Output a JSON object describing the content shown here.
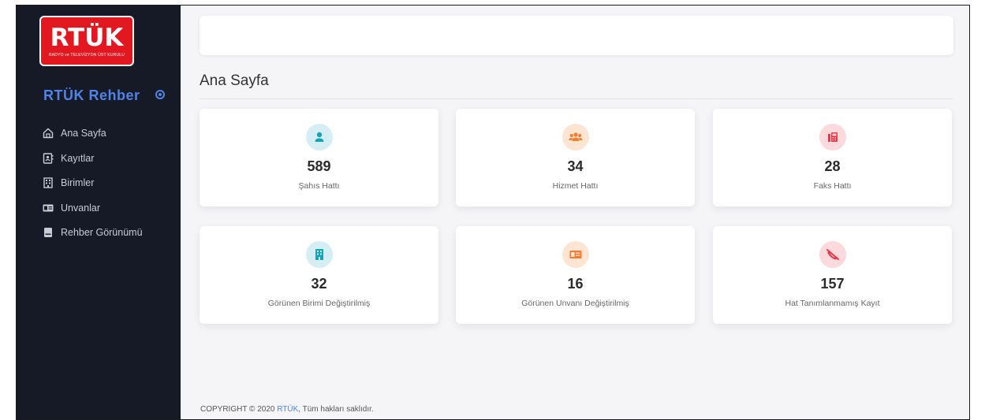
{
  "logo": {
    "main": "RTÜK",
    "sub": "RADYO ve TELEVİZYON ÜST KURULU"
  },
  "brand": {
    "title": "RTÜK Rehber"
  },
  "nav": {
    "items": [
      {
        "label": "Ana Sayfa",
        "icon": "home-icon"
      },
      {
        "label": "Kayıtlar",
        "icon": "contact-book-icon"
      },
      {
        "label": "Birimler",
        "icon": "building-icon"
      },
      {
        "label": "Unvanlar",
        "icon": "id-card-icon"
      },
      {
        "label": "Rehber Görünümü",
        "icon": "book-icon"
      }
    ]
  },
  "page": {
    "title": "Ana Sayfa"
  },
  "cards": [
    {
      "value": "589",
      "label": "Şahıs Hattı",
      "icon": "person-icon",
      "color": "#17a2b8",
      "bg": "#d4eef3"
    },
    {
      "value": "34",
      "label": "Hizmet Hattı",
      "icon": "users-icon",
      "color": "#f47c2c",
      "bg": "#fde4d3"
    },
    {
      "value": "28",
      "label": "Faks Hattı",
      "icon": "fax-icon",
      "color": "#e63946",
      "bg": "#fbd9dc"
    },
    {
      "value": "32",
      "label": "Görünen Birimi Değiştirilmiş",
      "icon": "building-icon",
      "color": "#17a2b8",
      "bg": "#d4eef3"
    },
    {
      "value": "16",
      "label": "Görünen Unvanı Değiştirilmiş",
      "icon": "id-card-icon",
      "color": "#f47c2c",
      "bg": "#fde4d3"
    },
    {
      "value": "157",
      "label": "Hat Tanımlanmamış Kayıt",
      "icon": "phone-slash-icon",
      "color": "#e63946",
      "bg": "#fbd9dc"
    }
  ],
  "footer": {
    "prefix": "COPYRIGHT © 2020 ",
    "link": "RTÜK",
    "suffix": ", Tüm hakları saklıdır."
  },
  "colors": {
    "sidebar": "#161a27",
    "accent": "#4f83e8",
    "brand_red": "#e2171f"
  }
}
